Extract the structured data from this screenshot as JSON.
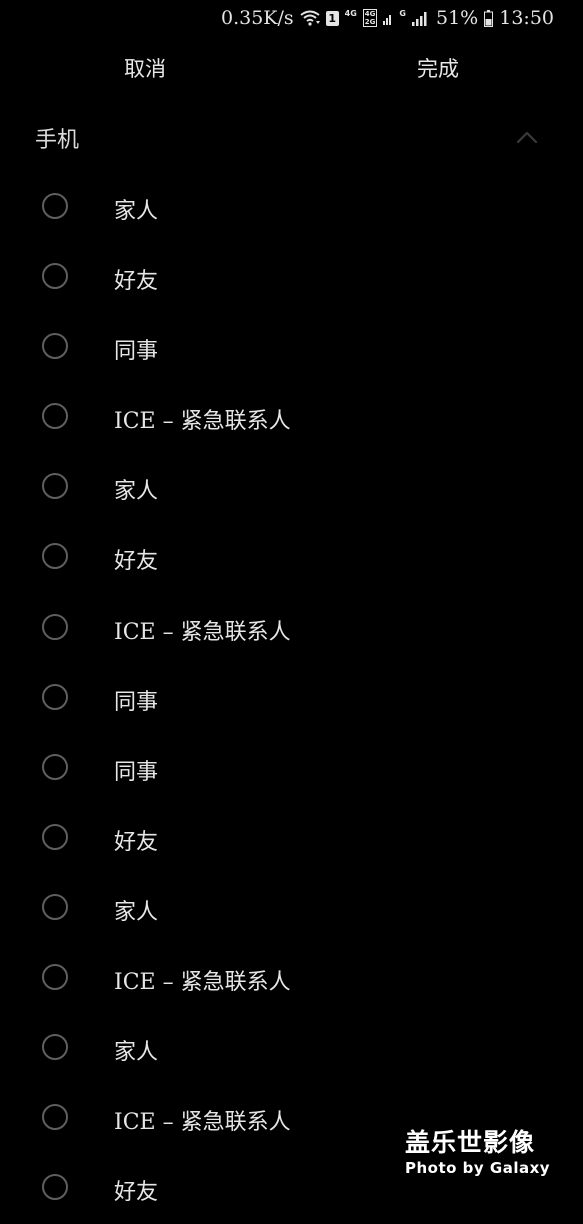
{
  "status_bar": {
    "net_speed": "0.35K/s",
    "wifi_icon": "wifi-icon",
    "sim_badge": "1",
    "net_type_1": "4G",
    "dual_net_top": "4G",
    "dual_net_bottom": "2G",
    "net_type_2": "G",
    "battery_pct": "51%",
    "clock": "13:50"
  },
  "action_bar": {
    "cancel_label": "取消",
    "done_label": "完成"
  },
  "section": {
    "title": "手机",
    "collapse_icon": "chevron-up-icon"
  },
  "items": [
    {
      "label": "家人",
      "checked": false
    },
    {
      "label": "好友",
      "checked": false
    },
    {
      "label": "同事",
      "checked": false
    },
    {
      "label": "ICE – 紧急联系人",
      "checked": false
    },
    {
      "label": "家人",
      "checked": false
    },
    {
      "label": "好友",
      "checked": false
    },
    {
      "label": "ICE – 紧急联系人",
      "checked": false
    },
    {
      "label": "同事",
      "checked": false
    },
    {
      "label": "同事",
      "checked": false
    },
    {
      "label": "好友",
      "checked": false
    },
    {
      "label": "家人",
      "checked": false
    },
    {
      "label": "ICE – 紧急联系人",
      "checked": false
    },
    {
      "label": "家人",
      "checked": false
    },
    {
      "label": "ICE – 紧急联系人",
      "checked": false
    },
    {
      "label": "好友",
      "checked": false
    }
  ],
  "watermark": {
    "title": "盖乐世影像",
    "subtitle": "Photo by Galaxy"
  },
  "colors": {
    "background": "#000000",
    "text": "#e6e6e6",
    "radio_border": "#5f5f5f",
    "chevron": "#3a3a3a"
  }
}
